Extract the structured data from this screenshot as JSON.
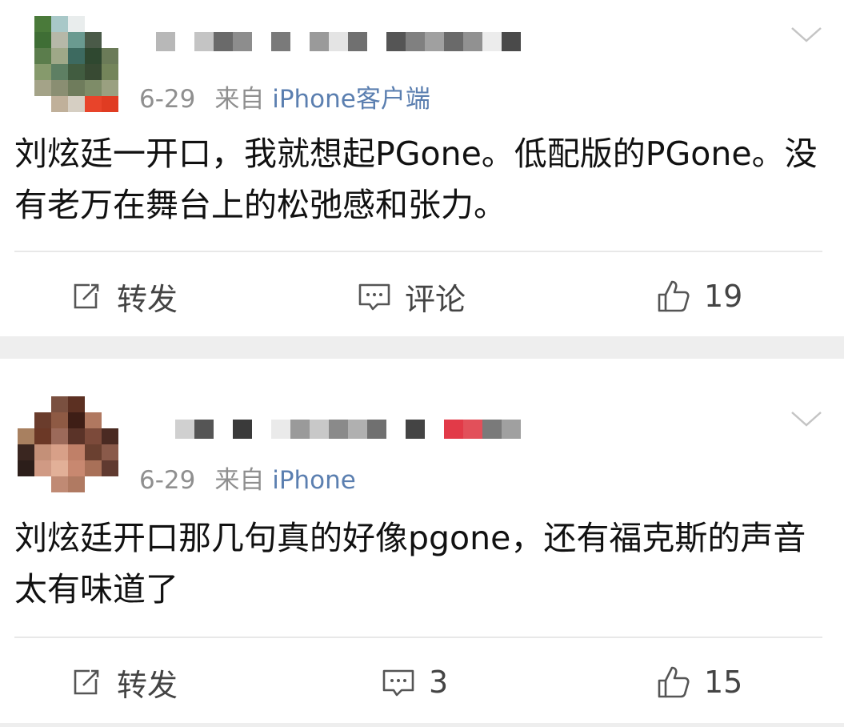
{
  "posts": [
    {
      "date": "6-29",
      "source_prefix": "来自",
      "source": "iPhone客户端",
      "content": "刘炫廷一开口，我就想起PGone。低配版的PGone。没有老万在舞台上的松弛感和张力。",
      "actions": {
        "repost_icon": "repost-icon",
        "repost_label": "转发",
        "comment_icon": "comment-icon",
        "comment_label": "评论",
        "like_icon": "like-icon",
        "like_count": "19"
      }
    },
    {
      "date": "6-29",
      "source_prefix": "来自",
      "source": "iPhone",
      "content": "刘炫廷开口那几句真的好像pgone，还有福克斯的声音太有味道了",
      "actions": {
        "repost_icon": "repost-icon",
        "repost_label": "转发",
        "comment_icon": "comment-icon",
        "comment_label": "3",
        "like_icon": "like-icon",
        "like_count": "15"
      }
    }
  ],
  "colors": {
    "source_link": "#5b7fb0",
    "meta_gray": "#8f8f8f",
    "separator_band": "#eeeeee"
  }
}
